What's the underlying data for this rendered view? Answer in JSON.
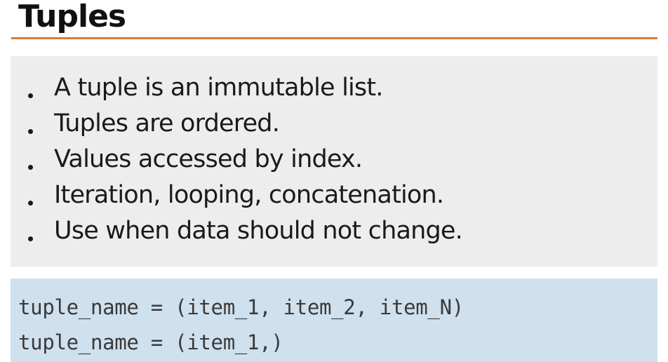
{
  "title": "Tuples",
  "bullets": [
    "A tuple is an immutable list.",
    "Tuples are ordered.",
    "Values accessed by index.",
    "Iteration, looping, concatenation.",
    "Use when data should not change."
  ],
  "code": [
    "tuple_name = (item_1, item_2, item_N)",
    "tuple_name = (item_1,)"
  ],
  "colors": {
    "title_rule": "#d97a3a",
    "bullet_panel": "#ededed",
    "code_panel": "#cfe0ee"
  }
}
